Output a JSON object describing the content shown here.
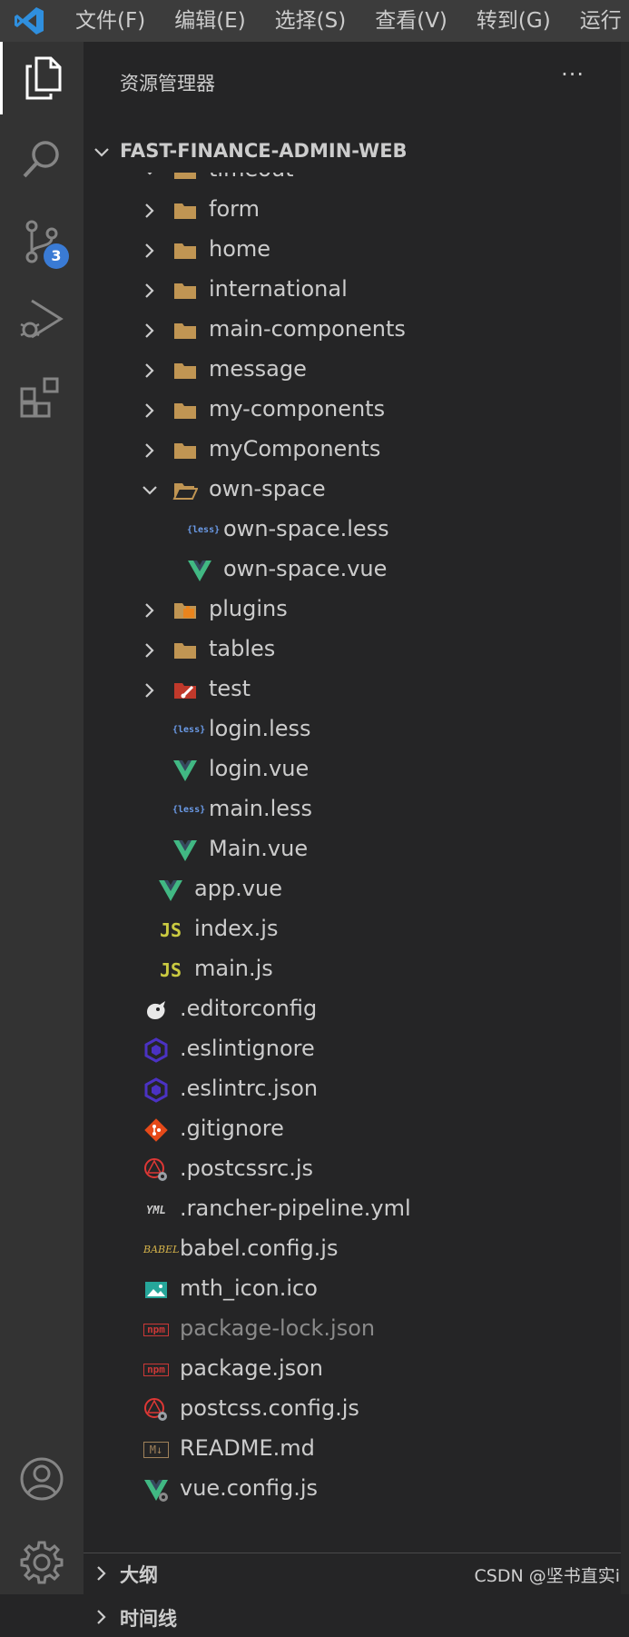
{
  "menubar": {
    "items": [
      "文件(F)",
      "编辑(E)",
      "选择(S)",
      "查看(V)",
      "转到(G)",
      "运行"
    ]
  },
  "activitybar": {
    "source_control_badge": "3"
  },
  "sidebar": {
    "title": "资源管理器",
    "more": "···",
    "root": "FAST-FINANCE-ADMIN-WEB",
    "tree": [
      {
        "label": "timeout",
        "icon": "folder-icon",
        "depth": 2,
        "expanded": true,
        "partial": true
      },
      {
        "label": "form",
        "icon": "folder-icon",
        "depth": 2,
        "expanded": false
      },
      {
        "label": "home",
        "icon": "folder-icon",
        "depth": 2,
        "expanded": false
      },
      {
        "label": "international",
        "icon": "folder-icon",
        "depth": 2,
        "expanded": false
      },
      {
        "label": "main-components",
        "icon": "folder-icon",
        "depth": 2,
        "expanded": false
      },
      {
        "label": "message",
        "icon": "folder-icon",
        "depth": 2,
        "expanded": false
      },
      {
        "label": "my-components",
        "icon": "folder-icon",
        "depth": 2,
        "expanded": false
      },
      {
        "label": "myComponents",
        "icon": "folder-icon",
        "depth": 2,
        "expanded": false
      },
      {
        "label": "own-space",
        "icon": "folder-open-icon",
        "depth": 2,
        "expanded": true
      },
      {
        "label": "own-space.less",
        "icon": "less-icon",
        "depth": 3
      },
      {
        "label": "own-space.vue",
        "icon": "vue-icon",
        "depth": 3
      },
      {
        "label": "plugins",
        "icon": "plugins-folder-icon",
        "depth": 2,
        "expanded": false
      },
      {
        "label": "tables",
        "icon": "folder-icon",
        "depth": 2,
        "expanded": false
      },
      {
        "label": "test",
        "icon": "test-folder-icon",
        "depth": 2,
        "expanded": false
      },
      {
        "label": "login.less",
        "icon": "less-icon",
        "depth": 2
      },
      {
        "label": "login.vue",
        "icon": "vue-icon",
        "depth": 2
      },
      {
        "label": "main.less",
        "icon": "less-icon",
        "depth": 2
      },
      {
        "label": "Main.vue",
        "icon": "vue-icon",
        "depth": 2
      },
      {
        "label": "app.vue",
        "icon": "vue-icon",
        "depth": 1
      },
      {
        "label": "index.js",
        "icon": "js-icon",
        "depth": 1
      },
      {
        "label": "main.js",
        "icon": "js-icon",
        "depth": 1
      },
      {
        "label": ".editorconfig",
        "icon": "editorconfig-icon",
        "depth": 0
      },
      {
        "label": ".eslintignore",
        "icon": "eslint-icon",
        "depth": 0
      },
      {
        "label": ".eslintrc.json",
        "icon": "eslint-icon",
        "depth": 0
      },
      {
        "label": ".gitignore",
        "icon": "git-icon",
        "depth": 0
      },
      {
        "label": ".postcssrc.js",
        "icon": "postcss-icon",
        "depth": 0
      },
      {
        "label": ".rancher-pipeline.yml",
        "icon": "yaml-icon",
        "depth": 0
      },
      {
        "label": "babel.config.js",
        "icon": "babel-icon",
        "depth": 0
      },
      {
        "label": "mth_icon.ico",
        "icon": "image-icon",
        "depth": 0
      },
      {
        "label": "package-lock.json",
        "icon": "npm-icon",
        "depth": 0,
        "dimmed": true
      },
      {
        "label": "package.json",
        "icon": "npm-icon",
        "depth": 0
      },
      {
        "label": "postcss.config.js",
        "icon": "postcss-icon",
        "depth": 0
      },
      {
        "label": "README.md",
        "icon": "markdown-icon",
        "depth": 0
      },
      {
        "label": "vue.config.js",
        "icon": "vue-config-icon",
        "depth": 0
      }
    ],
    "icon_text": {
      "less": "{less}",
      "js": "JS",
      "yaml": "YML",
      "babel": "BABEL",
      "npm": "npm",
      "md": "M↓"
    },
    "outline": "大纲",
    "timeline": "时间线"
  },
  "watermark": "CSDN @坚书直实i",
  "colors": {
    "folder": "#c09553",
    "vue": "#41b883",
    "js": "#cbcb41",
    "eslint": "#4b32c3",
    "git": "#e64a19",
    "accent": "#3a7bd5"
  }
}
